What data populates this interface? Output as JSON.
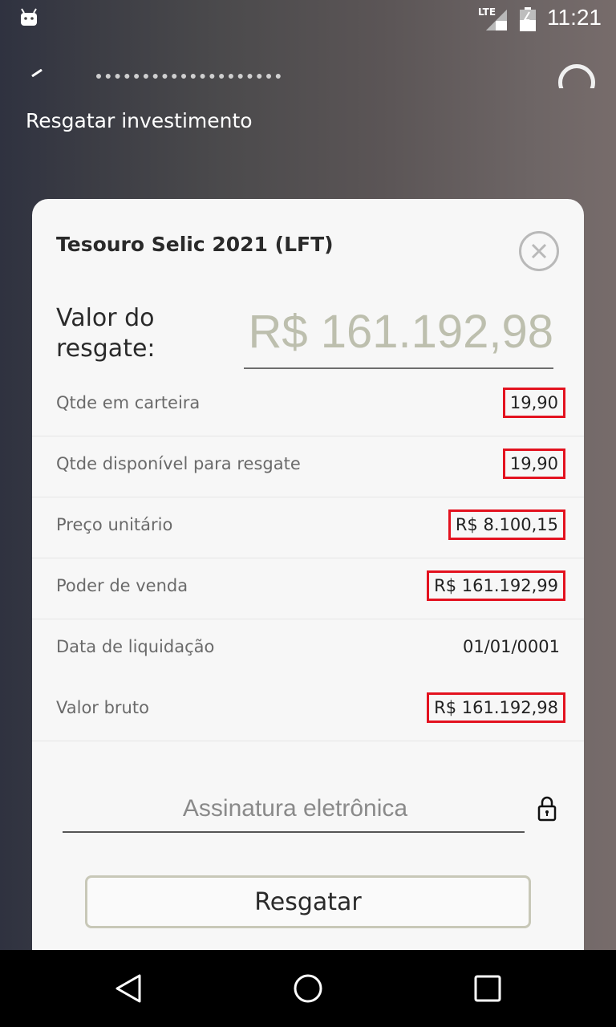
{
  "status_bar": {
    "network_label": "LTE",
    "time": "11:21",
    "icons": [
      "android-icon",
      "signal-icon",
      "battery-icon"
    ]
  },
  "page": {
    "heading": "Resgatar investimento"
  },
  "dialog": {
    "title": "Tesouro Selic 2021 (LFT)",
    "amount_label": "Valor do resgate:",
    "amount_value": "R$ 161.192,98",
    "rows": [
      {
        "label": "Qtde em carteira",
        "value": "19,90"
      },
      {
        "label": "Qtde disponível para resgate",
        "value": "19,90"
      },
      {
        "label": "Preço unitário",
        "value": "R$ 8.100,15"
      },
      {
        "label": "Poder de venda",
        "value": "R$ 161.192,99"
      },
      {
        "label": "Data de liquidação",
        "value": "01/01/0001"
      },
      {
        "label": "Valor bruto",
        "value": "R$ 161.192,98"
      }
    ],
    "signature_placeholder": "Assinatura eletrônica",
    "redeem_label": "Resgatar"
  },
  "colors": {
    "highlight_box": "#e3121f",
    "amount_text": "#bdbfae",
    "button_border": "#c8c8b8"
  }
}
